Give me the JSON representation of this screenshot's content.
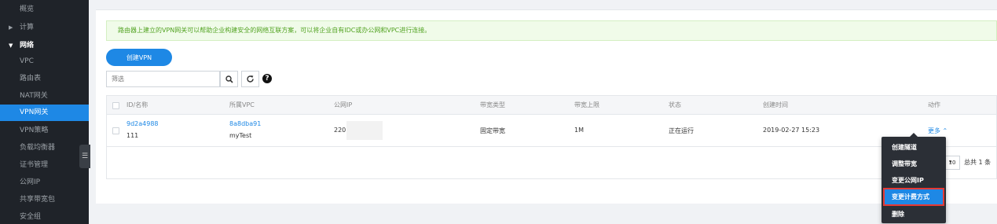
{
  "sidebar": {
    "items": [
      {
        "label": "概览",
        "kind": "item"
      },
      {
        "label": "计算",
        "kind": "collapsed"
      },
      {
        "label": "网络",
        "kind": "group"
      },
      {
        "label": "VPC",
        "kind": "item"
      },
      {
        "label": "路由表",
        "kind": "item"
      },
      {
        "label": "NAT网关",
        "kind": "item"
      },
      {
        "label": "VPN网关",
        "kind": "active"
      },
      {
        "label": "VPN策略",
        "kind": "item"
      },
      {
        "label": "负载均衡器",
        "kind": "item"
      },
      {
        "label": "证书管理",
        "kind": "item"
      },
      {
        "label": "公网IP",
        "kind": "item"
      },
      {
        "label": "共享带宽包",
        "kind": "item"
      },
      {
        "label": "安全组",
        "kind": "item"
      }
    ]
  },
  "info": "路由器上建立的VPN网关可以帮助企业构建安全的网络互联方案，可以将企业自有IDC或办公网和VPC进行连接。",
  "toolbar": {
    "create_label": "创建VPN",
    "filter_placeholder": "筛选",
    "search_icon": "search-icon",
    "refresh_icon": "refresh-icon",
    "help_icon": "help-icon"
  },
  "table": {
    "headers": [
      "ID/名称",
      "所属VPC",
      "公网IP",
      "带宽类型",
      "带宽上限",
      "状态",
      "创建时间",
      "动作"
    ],
    "rows": [
      {
        "id": "9d2a4988",
        "name": "111",
        "vpc_id": "8a8dba91",
        "vpc_name": "myTest",
        "public_ip": "220.2",
        "bandwidth_type": "固定带宽",
        "bandwidth_limit": "1M",
        "status": "正在运行",
        "created": "2019-02-27 15:23",
        "action": "更多"
      }
    ]
  },
  "pager": {
    "page_size": "10",
    "total": "总共 1 条"
  },
  "menu": {
    "items": [
      "创建隧道",
      "调整带宽",
      "变更公网IP",
      "变更计费方式",
      "删除"
    ],
    "highlighted_index": 3
  },
  "colors": {
    "sidebar_bg": "#1f2329",
    "accent": "#1e88e5",
    "info_text": "#52a322",
    "highlight_outline": "#e53935"
  }
}
